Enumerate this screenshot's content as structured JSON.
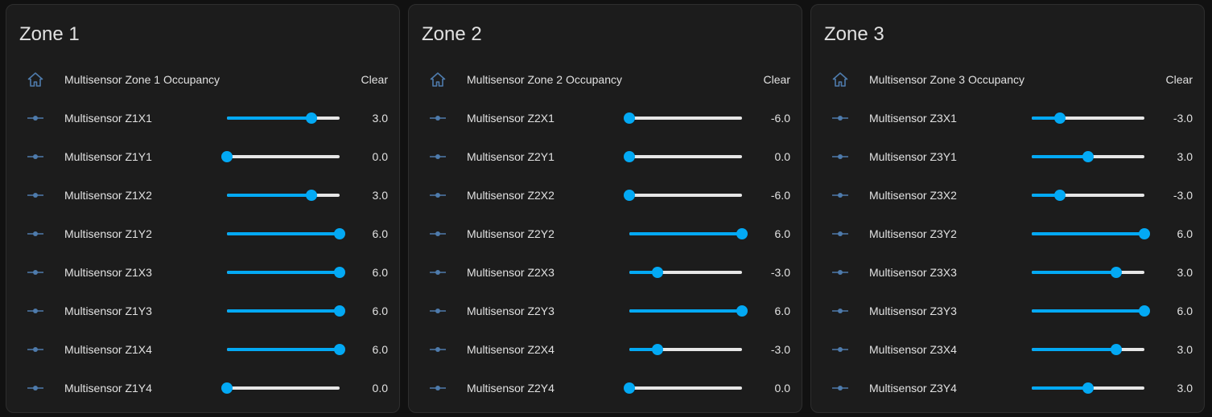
{
  "theme": {
    "accent": "#03a9f4",
    "card_background": "#1c1c1c",
    "page_background": "#111111",
    "icon_color": "#4e7bac",
    "text_color": "#e1e1e1",
    "track_color": "#e6e6e6"
  },
  "zones": [
    {
      "title": "Zone 1",
      "occupancy": {
        "label": "Multisensor Zone 1 Occupancy",
        "state": "Clear",
        "icon": "home-outline-icon"
      },
      "sliders": [
        {
          "label": "Multisensor Z1X1",
          "value": "3.0",
          "fraction": 0.75,
          "icon": "ray-vertex-icon"
        },
        {
          "label": "Multisensor Z1Y1",
          "value": "0.0",
          "fraction": 0.0,
          "icon": "ray-vertex-icon"
        },
        {
          "label": "Multisensor Z1X2",
          "value": "3.0",
          "fraction": 0.75,
          "icon": "ray-vertex-icon"
        },
        {
          "label": "Multisensor Z1Y2",
          "value": "6.0",
          "fraction": 1.0,
          "icon": "ray-vertex-icon"
        },
        {
          "label": "Multisensor Z1X3",
          "value": "6.0",
          "fraction": 1.0,
          "icon": "ray-vertex-icon"
        },
        {
          "label": "Multisensor Z1Y3",
          "value": "6.0",
          "fraction": 1.0,
          "icon": "ray-vertex-icon"
        },
        {
          "label": "Multisensor Z1X4",
          "value": "6.0",
          "fraction": 1.0,
          "icon": "ray-vertex-icon"
        },
        {
          "label": "Multisensor Z1Y4",
          "value": "0.0",
          "fraction": 0.0,
          "icon": "ray-vertex-icon"
        }
      ]
    },
    {
      "title": "Zone 2",
      "occupancy": {
        "label": "Multisensor Zone 2 Occupancy",
        "state": "Clear",
        "icon": "home-outline-icon"
      },
      "sliders": [
        {
          "label": "Multisensor Z2X1",
          "value": "-6.0",
          "fraction": 0.0,
          "icon": "ray-vertex-icon"
        },
        {
          "label": "Multisensor Z2Y1",
          "value": "0.0",
          "fraction": 0.0,
          "icon": "ray-vertex-icon"
        },
        {
          "label": "Multisensor Z2X2",
          "value": "-6.0",
          "fraction": 0.0,
          "icon": "ray-vertex-icon"
        },
        {
          "label": "Multisensor Z2Y2",
          "value": "6.0",
          "fraction": 1.0,
          "icon": "ray-vertex-icon"
        },
        {
          "label": "Multisensor Z2X3",
          "value": "-3.0",
          "fraction": 0.25,
          "icon": "ray-vertex-icon"
        },
        {
          "label": "Multisensor Z2Y3",
          "value": "6.0",
          "fraction": 1.0,
          "icon": "ray-vertex-icon"
        },
        {
          "label": "Multisensor Z2X4",
          "value": "-3.0",
          "fraction": 0.25,
          "icon": "ray-vertex-icon"
        },
        {
          "label": "Multisensor Z2Y4",
          "value": "0.0",
          "fraction": 0.0,
          "icon": "ray-vertex-icon"
        }
      ]
    },
    {
      "title": "Zone 3",
      "occupancy": {
        "label": "Multisensor Zone 3 Occupancy",
        "state": "Clear",
        "icon": "home-outline-icon"
      },
      "sliders": [
        {
          "label": "Multisensor Z3X1",
          "value": "-3.0",
          "fraction": 0.25,
          "icon": "ray-vertex-icon"
        },
        {
          "label": "Multisensor Z3Y1",
          "value": "3.0",
          "fraction": 0.5,
          "icon": "ray-vertex-icon"
        },
        {
          "label": "Multisensor Z3X2",
          "value": "-3.0",
          "fraction": 0.25,
          "icon": "ray-vertex-icon"
        },
        {
          "label": "Multisensor Z3Y2",
          "value": "6.0",
          "fraction": 1.0,
          "icon": "ray-vertex-icon"
        },
        {
          "label": "Multisensor Z3X3",
          "value": "3.0",
          "fraction": 0.75,
          "icon": "ray-vertex-icon"
        },
        {
          "label": "Multisensor Z3Y3",
          "value": "6.0",
          "fraction": 1.0,
          "icon": "ray-vertex-icon"
        },
        {
          "label": "Multisensor Z3X4",
          "value": "3.0",
          "fraction": 0.75,
          "icon": "ray-vertex-icon"
        },
        {
          "label": "Multisensor Z3Y4",
          "value": "3.0",
          "fraction": 0.5,
          "icon": "ray-vertex-icon"
        }
      ]
    }
  ]
}
